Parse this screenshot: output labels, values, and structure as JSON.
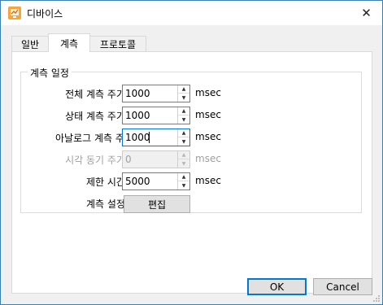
{
  "window": {
    "title": "디바이스",
    "close_symbol": "✕"
  },
  "tabs": [
    {
      "label": "일반",
      "active": false
    },
    {
      "label": "계측",
      "active": true
    },
    {
      "label": "프로토콜",
      "active": false
    }
  ],
  "group": {
    "title": "계측 일정",
    "rows": [
      {
        "label": "전체 계측 주기:",
        "value": "1000",
        "unit": "msec",
        "enabled": true
      },
      {
        "label": "상태 계측 주기:",
        "value": "1000",
        "unit": "msec",
        "enabled": true
      },
      {
        "label": "아날로그 계측 주기:",
        "value": "1000",
        "unit": "msec",
        "enabled": true,
        "focused": true
      },
      {
        "label": "시각 동기 주기:",
        "value": "0",
        "unit": "msec",
        "enabled": false
      },
      {
        "label": "제한 시간:",
        "value": "5000",
        "unit": "msec",
        "enabled": true
      }
    ],
    "settings_label": "계측 설정:",
    "edit_button": "편집"
  },
  "buttons": {
    "ok": "OK",
    "cancel": "Cancel"
  },
  "icons": {
    "app": "device-app-icon",
    "close": "close-icon",
    "spin_up": "spin-up-icon",
    "spin_down": "spin-down-icon",
    "resize_grip": "resize-grip-icon"
  },
  "colors": {
    "accent": "#0078d7",
    "app_icon": "#f3a63b"
  }
}
